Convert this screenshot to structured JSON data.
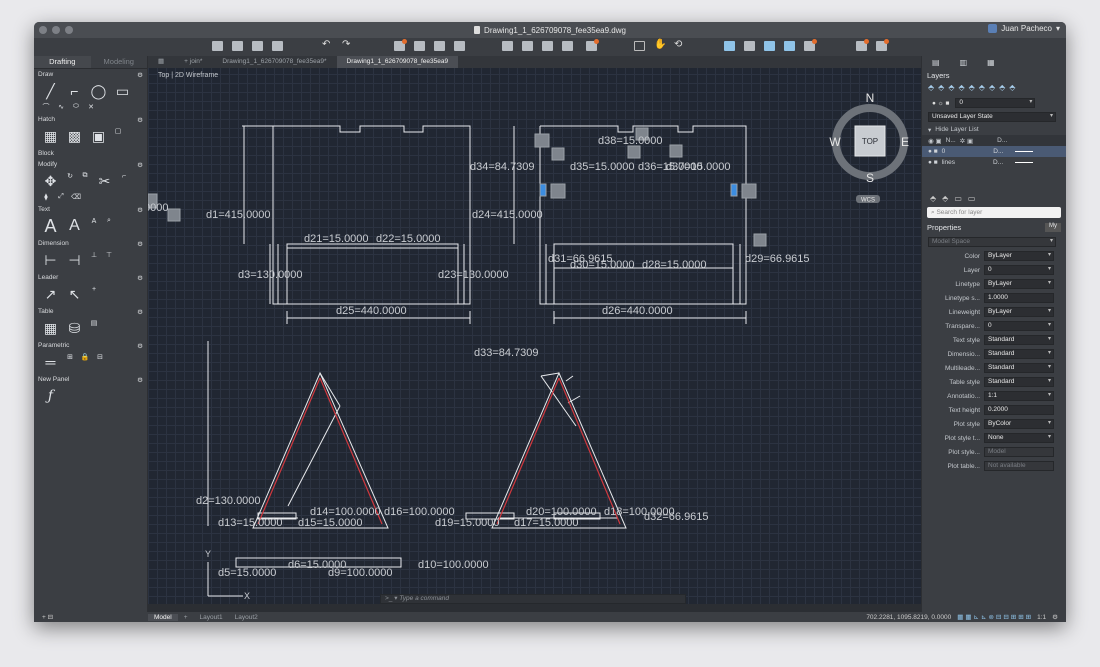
{
  "window": {
    "title": "Drawing1_1_626709078_fee35ea9.dwg",
    "user": "Juan Pacheco"
  },
  "left_panel": {
    "tabs": [
      "Drafting",
      "Modeling"
    ],
    "sections": [
      "Draw",
      "Hatch",
      "Block",
      "Modify",
      "Text",
      "Dimension",
      "Leader",
      "Table",
      "Parametric",
      "New Panel"
    ]
  },
  "doc_tabs": [
    "join*",
    "Drawing1_1_626709078_fee35ea9*",
    "Drawing1_1_626709078_fee35ea9"
  ],
  "view_label": "Top | 2D Wireframe",
  "viewcube": {
    "n": "N",
    "s": "S",
    "e": "E",
    "w": "W",
    "face": "TOP",
    "wcs": "WCS"
  },
  "dims": {
    "d1": "d1=415.0000",
    "d2": "d2=130.0000",
    "d3": "d3=130.0000",
    "d5": "d5=15.0000",
    "d6": "d6=15.0000",
    "d14": "d14=100.0000",
    "d15": "d15=15.0000",
    "d16": "d16=100.0000",
    "d17": "d17=15.0000",
    "d18": "d18=100.0000",
    "d19": "d19=15.0000",
    "d20": "d20=100.0000",
    "d21": "d21=15.0000",
    "d22": "d22=15.0000",
    "d23": "d23=130.0000",
    "d24": "d24=415.0000",
    "d25": "d25=440.0000",
    "d26": "d26=440.0000",
    "d29": "d29=66.9615",
    "d30": "d30=15.0000",
    "d31": "d31=66.9615",
    "d32": "d32=66.9615",
    "d33": "d33=84.7309",
    "d34": "d34=84.7309",
    "d35": "d35=15.0000",
    "d36": "d36=15.0000",
    "d37": "d37=15.0000",
    "d38": "d38=15.0000",
    "d28": "d28=15.0000",
    "d13": "d13=15.0000",
    "d10": "d10=100.0000",
    "d9": "d9=100.0000",
    "left_partial": "0000"
  },
  "ucs": {
    "x": "X",
    "y": "Y"
  },
  "right_panel": {
    "layers_title": "Layers",
    "current_layer": "0",
    "layer_state": "Unsaved Layer State",
    "hide_layer_list": "Hide Layer List",
    "layer_cols": [
      "N...",
      "D..."
    ],
    "layers": [
      {
        "name": "0",
        "desc": "D...",
        "selected": true
      },
      {
        "name": "lines",
        "desc": "D...",
        "selected": false
      }
    ],
    "search_placeholder": "Search for layer",
    "properties_title": "Properties",
    "properties_toggle": "My",
    "model_space": "Model Space",
    "props": [
      {
        "k": "Color",
        "v": "ByLayer"
      },
      {
        "k": "Layer",
        "v": "0"
      },
      {
        "k": "Linetype",
        "v": "ByLayer"
      },
      {
        "k": "Linetype s...",
        "v": "1.0000"
      },
      {
        "k": "Lineweight",
        "v": "ByLayer"
      },
      {
        "k": "Transpare...",
        "v": "0"
      },
      {
        "k": "Text style",
        "v": "Standard"
      },
      {
        "k": "Dimensio...",
        "v": "Standard"
      },
      {
        "k": "Multileade...",
        "v": "Standard"
      },
      {
        "k": "Table style",
        "v": "Standard"
      },
      {
        "k": "Annotatio...",
        "v": "1:1"
      },
      {
        "k": "Text height",
        "v": "0.2000"
      },
      {
        "k": "Plot style",
        "v": "ByColor"
      },
      {
        "k": "Plot style t...",
        "v": "None"
      },
      {
        "k": "Plot style...",
        "v": "Model"
      },
      {
        "k": "Plot table...",
        "v": "Not available"
      }
    ]
  },
  "command": {
    "placeholder": "Type a command"
  },
  "bottom": {
    "tabs": [
      "Model",
      "Layout1",
      "Layout2"
    ],
    "coords": "702.2281, 1095.8219, 0.0000",
    "scale": "1:1"
  },
  "colors": {
    "canvas": "#212732",
    "grid": "#2c3341",
    "geometry": "#e8eaed",
    "red": "#d2383e",
    "accent": "#5a7fb5"
  }
}
